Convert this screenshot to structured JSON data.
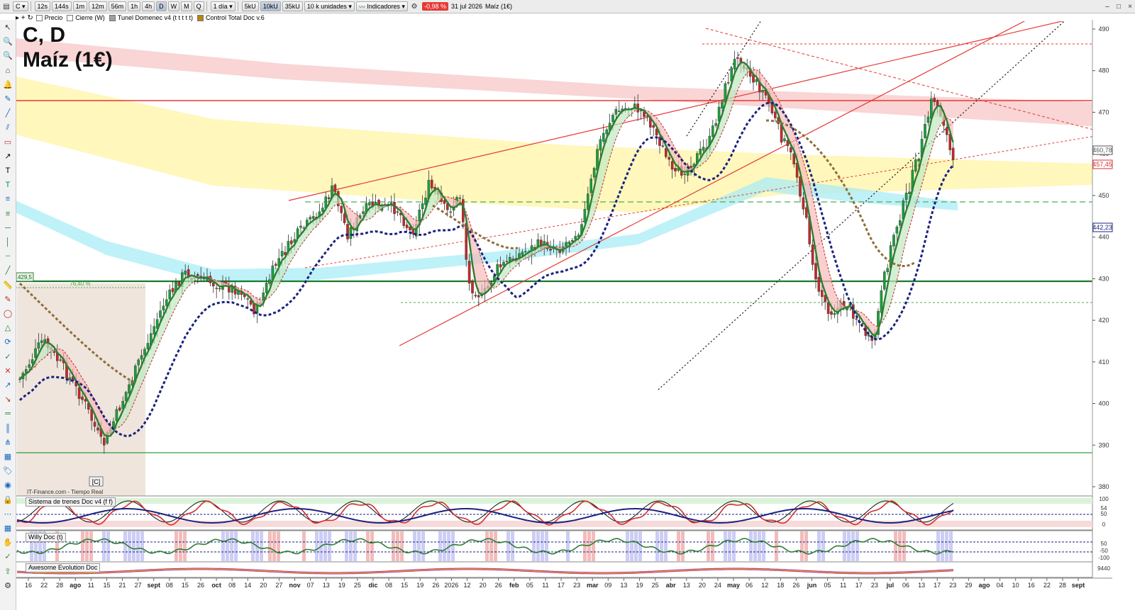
{
  "toolbar": {
    "symbol": "C",
    "timeframes": [
      "12s",
      "144s",
      "1m",
      "12m",
      "56m",
      "1h",
      "4h",
      "D",
      "W",
      "M",
      "Q"
    ],
    "active_timeframe": "D",
    "period": "1 día",
    "units": [
      "5kU",
      "10kU",
      "35kU"
    ],
    "active_unit": "10kU",
    "units_select": "10 k unidades",
    "indicators_label": "Indicadores",
    "change_badge": "-0,98 %",
    "date": "31 jul 2026",
    "instrument": "Maíz (1€)"
  },
  "legend": {
    "items": [
      "Precio",
      "Cierre (W)",
      "Tunel Domenec v4 (t t t t t)",
      "Control Total Doc v.6"
    ]
  },
  "main_chart": {
    "title_line1": "C, D",
    "title_line2": "Maíz (1€)",
    "source": "IT-Finance.com - Tiempo Real",
    "marker": "[C]",
    "left_label": "429,5",
    "fib_label": "76,40 %",
    "price_axis": [
      "490",
      "480",
      "470",
      "460",
      "450",
      "440",
      "430",
      "420",
      "410",
      "400",
      "390",
      "380"
    ],
    "price_tags": [
      {
        "label": "460,78",
        "color": "#555555"
      },
      {
        "label": "457,45",
        "color": "#d32f2f"
      },
      {
        "label": "442,23",
        "color": "#1a237e"
      }
    ],
    "colors": {
      "up": "#1b9e3a",
      "down": "#c62828",
      "red_line": "#e53935",
      "green_line": "#2e7d32",
      "navy_dots": "#1a237e",
      "brown_dots": "#8d6e3a"
    }
  },
  "panes": [
    {
      "label": "Sistema de trenes Doc v4 (f f)",
      "right_values": [
        "100",
        "54",
        "50",
        "0"
      ]
    },
    {
      "label": "Willy Doc (t)",
      "right_values": [
        "50",
        "-50",
        "-100"
      ]
    },
    {
      "label": "Awesome Evolution Doc",
      "right_values": [
        "9440"
      ]
    }
  ],
  "time_axis": [
    "16",
    "22",
    "28",
    "ago",
    "11",
    "15",
    "21",
    "27",
    "sept",
    "08",
    "15",
    "26",
    "oct",
    "08",
    "14",
    "20",
    "27",
    "nov",
    "07",
    "13",
    "19",
    "25",
    "dic",
    "08",
    "15",
    "19",
    "26",
    "2026",
    "12",
    "20",
    "26",
    "feb",
    "05",
    "11",
    "17",
    "23",
    "mar",
    "09",
    "13",
    "19",
    "25",
    "abr",
    "13",
    "20",
    "24",
    "may",
    "06",
    "12",
    "18",
    "26",
    "jun",
    "05",
    "11",
    "17",
    "23",
    "jul",
    "06",
    "13",
    "17",
    "23",
    "29",
    "ago",
    "04",
    "10",
    "16",
    "22",
    "28",
    "sept"
  ],
  "left_tools": [
    "cursor-icon",
    "zoom-icon",
    "zoom-out-icon",
    "magnet-icon",
    "bell-icon",
    "pencil-icon",
    "line-icon",
    "channel-icon",
    "rectangle-icon",
    "arrow-icon",
    "text-icon",
    "text-alt-icon",
    "fib-icon",
    "fib-alt-icon",
    "hline-icon",
    "vline-icon",
    "hline-dash-icon",
    "ray-icon",
    "ruler-icon",
    "brush-icon",
    "ellipse-icon",
    "triangle-icon",
    "cycle-icon",
    "check-icon",
    "delete-icon",
    "trend-up-icon",
    "trend-down-icon",
    "hline2-icon",
    "vline2-icon",
    "pitchfork-icon",
    "gann-icon",
    "label-icon",
    "eye-icon",
    "lock-icon",
    "dots-icon",
    "calendar-icon",
    "hand-icon",
    "check2-icon",
    "export-icon",
    "settings-icon"
  ]
}
